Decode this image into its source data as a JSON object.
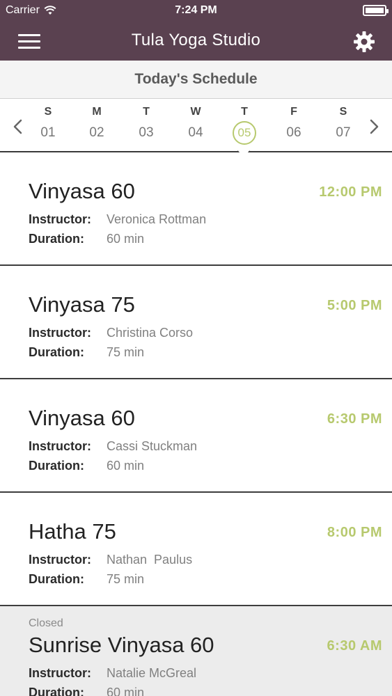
{
  "status_bar": {
    "carrier": "Carrier",
    "time": "7:24 PM"
  },
  "header": {
    "title": "Tula Yoga Studio",
    "menu_icon": "hamburger-menu-icon",
    "settings_icon": "gear-icon"
  },
  "subheader": {
    "label": "Today's Schedule"
  },
  "week": {
    "days": [
      {
        "dow": "S",
        "num": "01"
      },
      {
        "dow": "M",
        "num": "02"
      },
      {
        "dow": "T",
        "num": "03"
      },
      {
        "dow": "W",
        "num": "04"
      },
      {
        "dow": "T",
        "num": "05",
        "selected": true
      },
      {
        "dow": "F",
        "num": "06"
      },
      {
        "dow": "S",
        "num": "07"
      }
    ],
    "selected_index": 4
  },
  "labels": {
    "instructor": "Instructor:",
    "duration": "Duration:"
  },
  "classes": [
    {
      "name": "Vinyasa 60",
      "time": "12:00 PM",
      "instructor": "Veronica Rottman",
      "duration": "60 min"
    },
    {
      "name": "Vinyasa 75",
      "time": "5:00 PM",
      "instructor": "Christina Corso",
      "duration": "75 min"
    },
    {
      "name": "Vinyasa 60",
      "time": "6:30 PM",
      "instructor": "Cassi Stuckman",
      "duration": "60 min"
    },
    {
      "name": "Hatha 75",
      "time": "8:00 PM",
      "instructor": "Nathan  Paulus",
      "duration": "75 min"
    },
    {
      "name": "Sunrise Vinyasa 60",
      "time": "6:30 AM",
      "instructor": "Natalie McGreal",
      "duration": "60 min",
      "status": "Closed"
    }
  ],
  "colors": {
    "header_bg": "#5a4150",
    "accent": "#b7c96e",
    "closed_bg": "#ececec"
  }
}
